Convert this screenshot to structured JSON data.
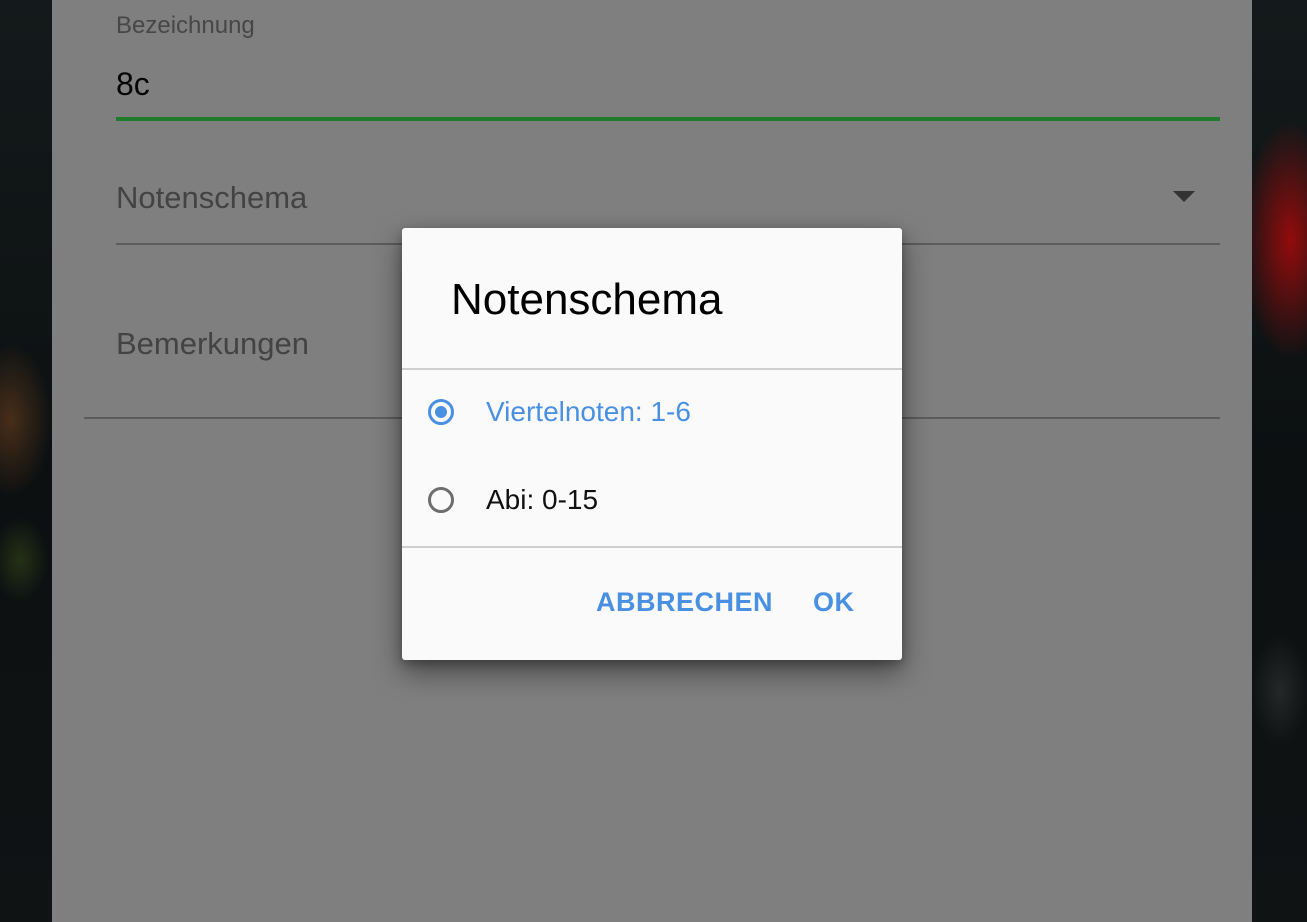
{
  "form": {
    "name_label": "Bezeichnung",
    "name_value": "8c",
    "grading_scheme_placeholder": "Notenschema",
    "remarks_placeholder": "Bemerkungen",
    "accent_color": "#1f7a2a"
  },
  "dialog": {
    "title": "Notenschema",
    "options": [
      {
        "label": "Viertelnoten: 1-6",
        "selected": true
      },
      {
        "label": "Abi: 0-15",
        "selected": false
      }
    ],
    "cancel_label": "ABBRECHEN",
    "ok_label": "OK",
    "accent_color": "#4a90e2"
  },
  "icons": {
    "dropdown": "chevron-down-icon",
    "radio_selected": "radio-checked-icon",
    "radio_unselected": "radio-unchecked-icon"
  }
}
